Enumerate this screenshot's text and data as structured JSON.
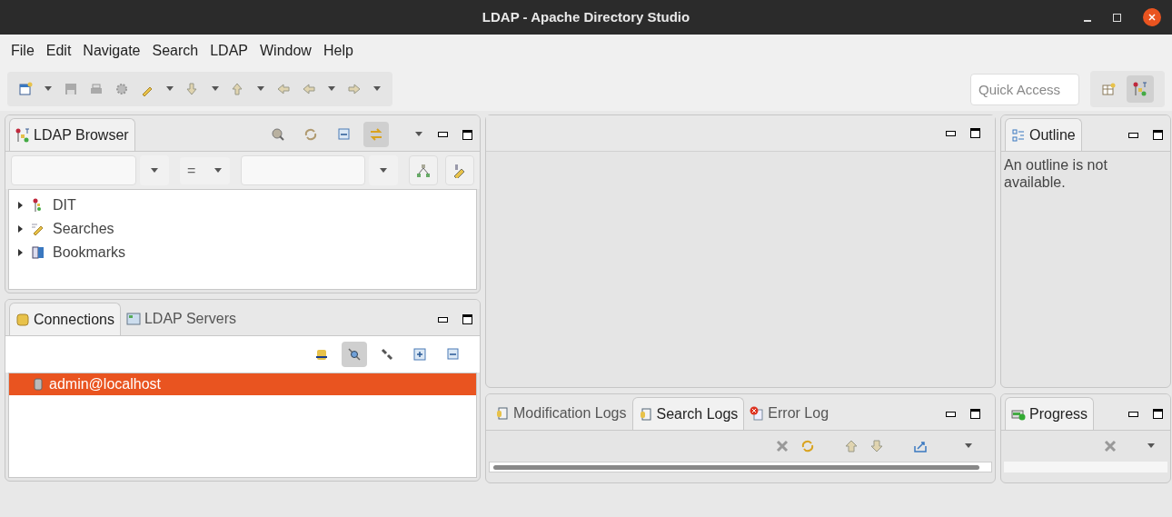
{
  "window": {
    "title": "LDAP - Apache Directory Studio"
  },
  "menu": [
    "File",
    "Edit",
    "Navigate",
    "Search",
    "LDAP",
    "Window",
    "Help"
  ],
  "quick_access": {
    "placeholder": "Quick Access"
  },
  "browser": {
    "tabs": [
      {
        "label": "LDAP Browser",
        "selected": true
      }
    ],
    "toolbar": [
      {
        "kind": "search",
        "pressed": false
      },
      {
        "kind": "refresh",
        "pressed": false
      },
      {
        "kind": "collapse",
        "pressed": false
      },
      {
        "kind": "link",
        "pressed": true
      }
    ],
    "filter_operator": "=",
    "tree": [
      {
        "label": "DIT",
        "kind": "dit",
        "expanded": false
      },
      {
        "label": "Searches",
        "kind": "searches",
        "expanded": false
      },
      {
        "label": "Bookmarks",
        "kind": "bookmarks",
        "expanded": false
      }
    ]
  },
  "connections": {
    "tabs": [
      {
        "label": "Connections",
        "selected": true
      },
      {
        "label": "LDAP Servers",
        "selected": false
      }
    ],
    "toolbar": [
      {
        "kind": "new",
        "pressed": false
      },
      {
        "kind": "connect",
        "pressed": true
      },
      {
        "kind": "disconnect",
        "pressed": false
      },
      {
        "kind": "expand",
        "pressed": false
      },
      {
        "kind": "collapse",
        "pressed": false
      }
    ],
    "rows": [
      {
        "label": "admin@localhost",
        "selected": true
      }
    ]
  },
  "outline": {
    "tabs": [
      {
        "label": "Outline",
        "selected": true
      }
    ],
    "message": "An outline is not available."
  },
  "logs": {
    "tabs": [
      {
        "label": "Modification Logs",
        "selected": false
      },
      {
        "label": "Search Logs",
        "selected": true
      },
      {
        "label": "Error Log",
        "selected": false
      }
    ]
  },
  "progress": {
    "tabs": [
      {
        "label": "Progress",
        "selected": true
      }
    ]
  }
}
